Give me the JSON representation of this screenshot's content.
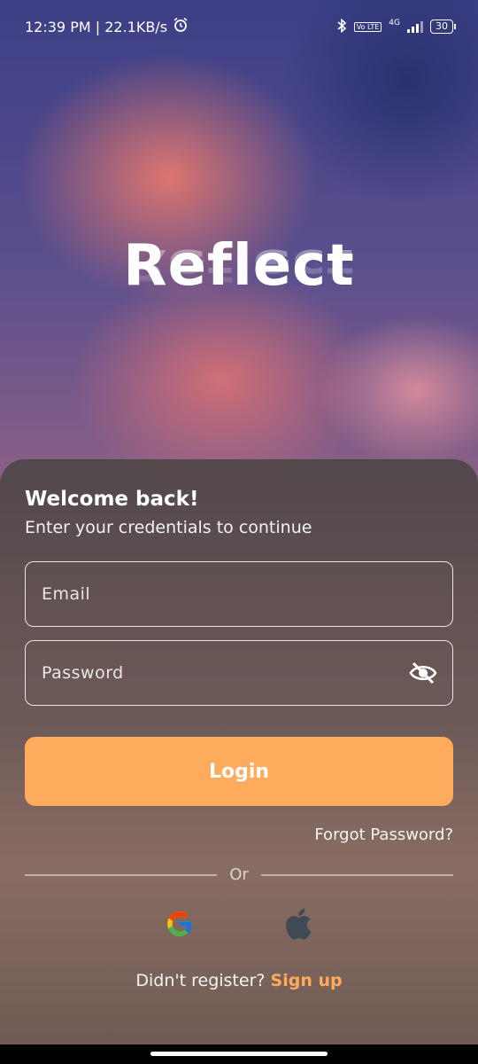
{
  "status_bar": {
    "time_speed": "12:39 PM | 22.1KB/s",
    "network": "4G",
    "volte": "Vo LTE",
    "battery": "30"
  },
  "app": {
    "logo": "Reflect"
  },
  "login_card": {
    "title": "Welcome back!",
    "subtitle": "Enter your credentials to continue",
    "email_placeholder": "Email",
    "password_placeholder": "Password",
    "login_label": "Login",
    "forgot_label": "Forgot Password?",
    "divider_label": "Or",
    "register_prompt": "Didn't register?",
    "signup_label": "Sign up"
  },
  "colors": {
    "accent": "#ffab5e"
  },
  "icons": {
    "password_toggle": "eye-off-icon",
    "social": [
      "google-icon",
      "apple-icon"
    ]
  }
}
